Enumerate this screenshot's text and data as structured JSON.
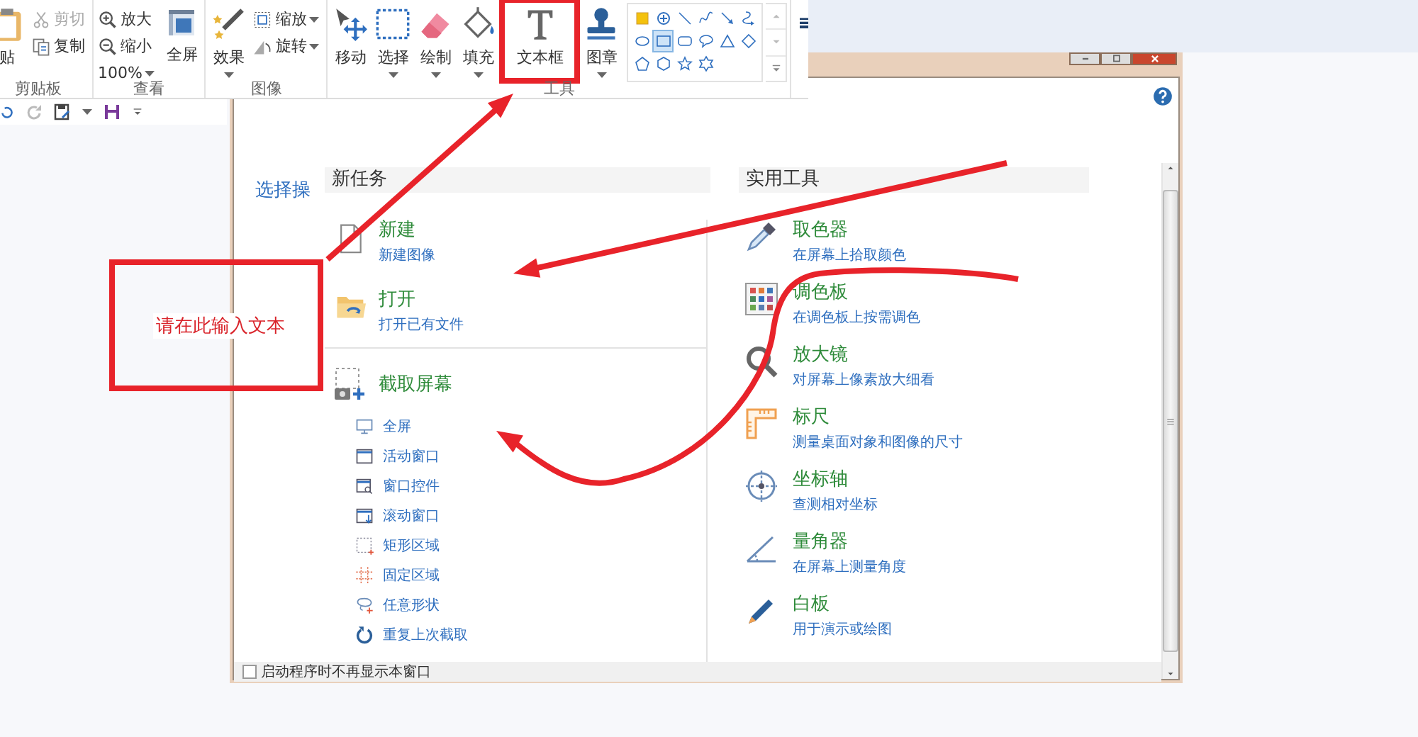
{
  "ribbon": {
    "groups": [
      {
        "label": "剪贴板",
        "tools": [
          {
            "kind": "large",
            "label": "贴",
            "dropdown": false,
            "disabled": false
          },
          {
            "kind": "small",
            "label": "剪切",
            "dropdown": false,
            "disabled": true
          },
          {
            "kind": "small",
            "label": "复制",
            "dropdown": false,
            "disabled": false
          }
        ]
      },
      {
        "label": "查看",
        "tools": [
          {
            "kind": "small",
            "label": "放大",
            "dropdown": false,
            "disabled": false
          },
          {
            "kind": "small",
            "label": "缩小",
            "dropdown": false,
            "disabled": false
          },
          {
            "kind": "small",
            "label": "100%",
            "dropdown": true,
            "disabled": false
          },
          {
            "kind": "large",
            "label": "全屏",
            "dropdown": false,
            "disabled": false
          }
        ]
      },
      {
        "label": "图像",
        "tools": [
          {
            "kind": "large",
            "label": "效果",
            "dropdown": true,
            "disabled": false
          },
          {
            "kind": "small",
            "label": "缩放",
            "dropdown": true,
            "disabled": false
          },
          {
            "kind": "small",
            "label": "旋转",
            "dropdown": true,
            "disabled": false
          }
        ]
      },
      {
        "label": "工具",
        "tools": [
          {
            "kind": "large",
            "label": "移动",
            "dropdown": false,
            "disabled": false
          },
          {
            "kind": "large",
            "label": "选择",
            "dropdown": true,
            "disabled": false
          },
          {
            "kind": "large",
            "label": "绘制",
            "dropdown": true,
            "disabled": false
          },
          {
            "kind": "large",
            "label": "填充",
            "dropdown": true,
            "disabled": false
          },
          {
            "kind": "large",
            "label": "文本框",
            "dropdown": false,
            "disabled": false,
            "highlighted": true
          },
          {
            "kind": "large",
            "label": "图章",
            "dropdown": true,
            "disabled": false
          }
        ]
      }
    ],
    "gallery": [
      {
        "selected": false
      },
      {
        "selected": false
      },
      {
        "selected": false
      },
      {
        "selected": false
      },
      {
        "selected": false
      },
      {
        "selected": false
      },
      {
        "selected": false
      },
      {
        "selected": true
      },
      {
        "selected": false
      },
      {
        "selected": false
      },
      {
        "selected": false
      },
      {
        "selected": false
      },
      {
        "selected": false
      },
      {
        "selected": false
      },
      {
        "selected": false
      },
      {
        "selected": false
      }
    ]
  },
  "dialog": {
    "side_label": "选择操",
    "new_task": {
      "title": "新任务",
      "tasks": [
        {
          "title": "新建",
          "subtitle": "新建图像"
        },
        {
          "title": "打开",
          "subtitle": "打开已有文件"
        }
      ],
      "capture": {
        "title": "截取屏幕",
        "modes": [
          "全屏",
          "活动窗口",
          "窗口控件",
          "滚动窗口",
          "矩形区域",
          "固定区域",
          "任意形状",
          "重复上次截取"
        ]
      }
    },
    "tools": {
      "title": "实用工具",
      "items": [
        {
          "title": "取色器",
          "subtitle": "在屏幕上拾取颜色"
        },
        {
          "title": "调色板",
          "subtitle": "在调色板上按需调色"
        },
        {
          "title": "放大镜",
          "subtitle": "对屏幕上像素放大细看"
        },
        {
          "title": "标尺",
          "subtitle": "测量桌面对象和图像的尺寸"
        },
        {
          "title": "坐标轴",
          "subtitle": "查测相对坐标"
        },
        {
          "title": "量角器",
          "subtitle": "在屏幕上测量角度"
        },
        {
          "title": "白板",
          "subtitle": "用于演示或绘图"
        }
      ]
    },
    "footer": {
      "label": "启动程序时不再显示本窗口",
      "checked": false
    }
  },
  "annotation": {
    "text": "请在此输入文本"
  }
}
